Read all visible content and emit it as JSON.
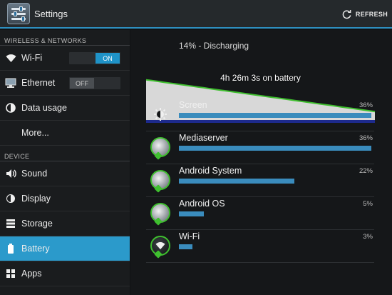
{
  "topbar": {
    "title": "Settings",
    "refresh_label": "REFRESH"
  },
  "sidebar": {
    "sections": [
      {
        "header": "WIRELESS & NETWORKS"
      },
      {
        "header": "DEVICE"
      }
    ],
    "items": [
      {
        "label": "Wi-Fi",
        "icon": "wifi-icon",
        "toggle": "ON"
      },
      {
        "label": "Ethernet",
        "icon": "ethernet-icon",
        "toggle": "OFF"
      },
      {
        "label": "Data usage",
        "icon": "data-usage-icon"
      },
      {
        "label": "More...",
        "icon": ""
      },
      {
        "label": "Sound",
        "icon": "sound-icon"
      },
      {
        "label": "Display",
        "icon": "display-icon"
      },
      {
        "label": "Storage",
        "icon": "storage-icon"
      },
      {
        "label": "Battery",
        "icon": "battery-icon",
        "selected": true
      },
      {
        "label": "Apps",
        "icon": "apps-icon"
      }
    ]
  },
  "battery": {
    "status": "14% - Discharging",
    "graph_label": "4h 26m 3s on battery",
    "level_start": 0.67,
    "level_end": 0.14,
    "colors": {
      "line": "#3fbf2f",
      "fill": "#d8d8d8",
      "bar": "#3a8cbd",
      "accent": "#2b9acb"
    }
  },
  "apps": [
    {
      "name": "Screen",
      "percent": "36%",
      "fraction": 1.0,
      "icon": "brightness-icon"
    },
    {
      "name": "Mediaserver",
      "percent": "36%",
      "fraction": 1.0,
      "icon": "android-icon"
    },
    {
      "name": "Android System",
      "percent": "22%",
      "fraction": 0.6,
      "icon": "android-icon"
    },
    {
      "name": "Android OS",
      "percent": "5%",
      "fraction": 0.13,
      "icon": "android-icon"
    },
    {
      "name": "Wi-Fi",
      "percent": "3%",
      "fraction": 0.07,
      "icon": "wifi-app-icon"
    }
  ]
}
